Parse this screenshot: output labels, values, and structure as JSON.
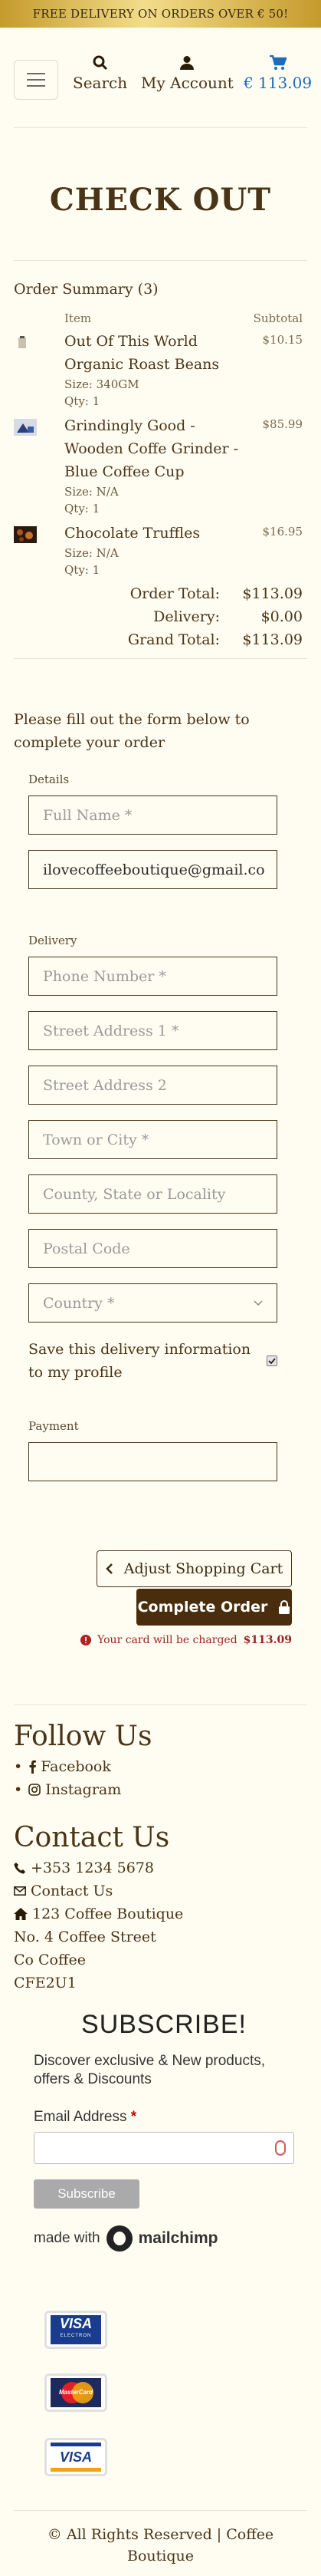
{
  "banner": {
    "text": "FREE DELIVERY ON ORDERS OVER € 50!"
  },
  "header": {
    "menu_icon": "hamburger-icon",
    "search_label": "Search",
    "account_label": "My Account",
    "cart_total": "€ 113.09",
    "cart_color": "#1e6bb8"
  },
  "page": {
    "title": "CHECK OUT"
  },
  "order_summary": {
    "title": "Order Summary (3)",
    "col_item": "Item",
    "col_subtotal": "Subtotal",
    "items": [
      {
        "name": "Out Of This World Organic Roast Beans",
        "size": "Size: 340GM",
        "qty": "Qty: 1",
        "price": "$10.15"
      },
      {
        "name": "Grindingly Good - Wooden Coffe Grinder - Blue Coffee Cup",
        "size": "Size: N/A",
        "qty": "Qty: 1",
        "price": "$85.99"
      },
      {
        "name": "Chocolate Truffles",
        "size": "Size: N/A",
        "qty": "Qty: 1",
        "price": "$16.95"
      }
    ],
    "order_total_label": "Order Total:",
    "order_total": "$113.09",
    "delivery_label": "Delivery:",
    "delivery": "$0.00",
    "grand_total_label": "Grand Total:",
    "grand_total": "$113.09"
  },
  "form": {
    "intro": "Please fill out the form below to complete your order",
    "details_label": "Details",
    "full_name_placeholder": "Full Name *",
    "email_value": "ilovecoffeeboutique@gmail.co",
    "delivery_label": "Delivery",
    "phone_placeholder": "Phone Number *",
    "street1_placeholder": "Street Address 1 *",
    "street2_placeholder": "Street Address 2",
    "town_placeholder": "Town or City *",
    "county_placeholder": "County, State or Locality",
    "postal_placeholder": "Postal Code",
    "country_placeholder": "Country *",
    "save_info_label": "Save this delivery information to my profile",
    "save_info_checked": true,
    "payment_label": "Payment"
  },
  "actions": {
    "adjust_label": "Adjust Shopping Cart",
    "complete_label": "Complete Order",
    "charge_note": "Your card will be charged",
    "charge_amount": "$113.09"
  },
  "footer": {
    "follow_title": "Follow Us",
    "social": [
      {
        "label": "Facebook",
        "icon": "facebook-icon"
      },
      {
        "label": "Instagram",
        "icon": "instagram-icon"
      }
    ],
    "contact_title": "Contact Us",
    "phone": "+353 1234 5678",
    "contact_link": "Contact Us",
    "address_line1": "123 Coffee Boutique",
    "address_line2": "No. 4 Coffee Street",
    "address_line3": "Co Coffee",
    "address_line4": "CFE2U1",
    "copyright": "All Rights Reserved | Coffee Boutique"
  },
  "newsletter": {
    "title": "SUBSCRIBE!",
    "description": "Discover exclusive & New products, offers & Discounts",
    "email_label": "Email Address",
    "required_mark": "*",
    "button_label": "Subscribe",
    "made_with": "made with",
    "brand": "mailchimp"
  },
  "payment_cards": [
    {
      "name": "VISA",
      "sub": "ELECTRON"
    },
    {
      "name": "MasterCard"
    },
    {
      "name": "VISA"
    }
  ]
}
